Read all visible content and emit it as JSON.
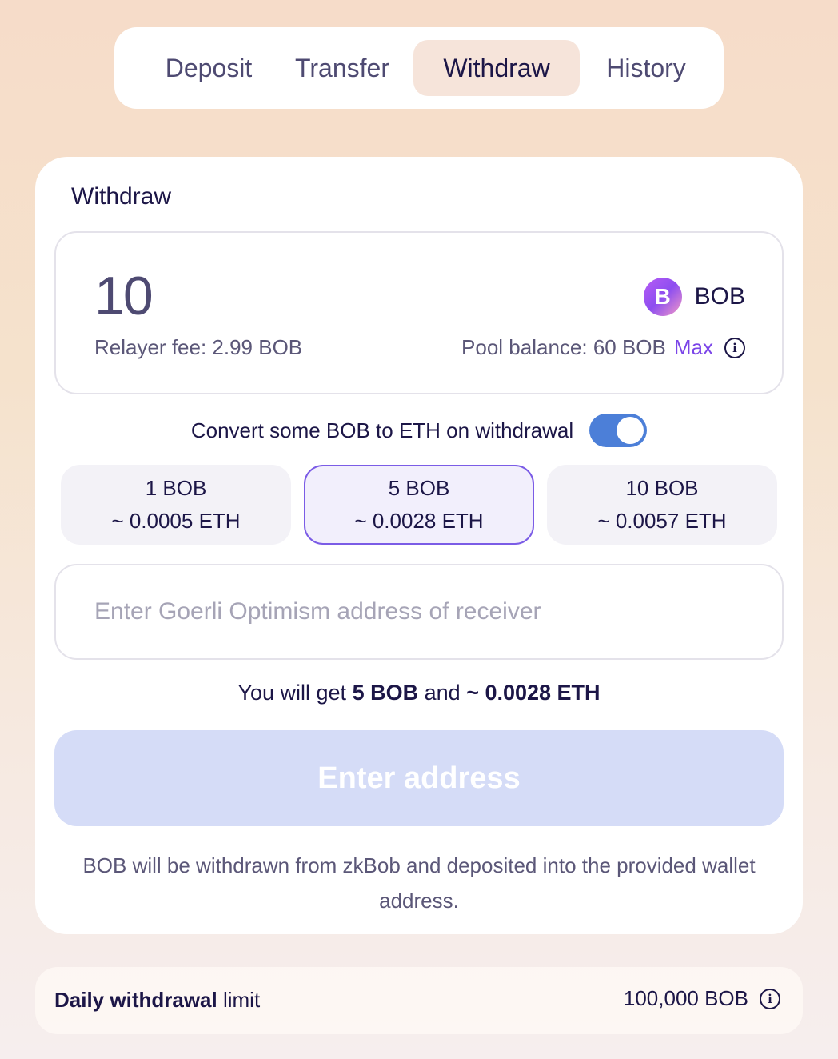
{
  "tabs": [
    {
      "label": "Deposit",
      "active": false
    },
    {
      "label": "Transfer",
      "active": false
    },
    {
      "label": "Withdraw",
      "active": true
    },
    {
      "label": "History",
      "active": false
    }
  ],
  "card": {
    "title": "Withdraw",
    "amount": "10",
    "token": {
      "logo_letter": "B",
      "name": "BOB",
      "icon": "bob-token-icon"
    },
    "relayer_fee": "Relayer fee: 2.99 BOB",
    "pool_balance": "Pool balance: 60 BOB",
    "max_label": "Max",
    "info_symbol": "i",
    "convert_label": "Convert some BOB to ETH on withdrawal",
    "convert_enabled": true,
    "presets": [
      {
        "amount": "1 BOB",
        "eth": "~ 0.0005 ETH",
        "selected": false
      },
      {
        "amount": "5 BOB",
        "eth": "~ 0.0028 ETH",
        "selected": true
      },
      {
        "amount": "10 BOB",
        "eth": "~ 0.0057 ETH",
        "selected": false
      }
    ],
    "address_placeholder": "Enter Goerli Optimism address of receiver",
    "address_value": "",
    "summary": {
      "prefix": "You will get",
      "bob": "5 BOB",
      "middle": "and",
      "eth": "~ 0.0028 ETH"
    },
    "submit_label": "Enter address",
    "note": "BOB will be withdrawn from zkBob and deposited into the provided wallet address."
  },
  "limit": {
    "label_bold": "Daily withdrawal",
    "label_rest": "limit",
    "value": "100,000 BOB",
    "info_symbol": "i"
  },
  "colors": {
    "accent": "#7b45e8",
    "toggle": "#4c7fd8",
    "button_disabled": "#d5dcf7",
    "text_dark": "#1c1647"
  }
}
